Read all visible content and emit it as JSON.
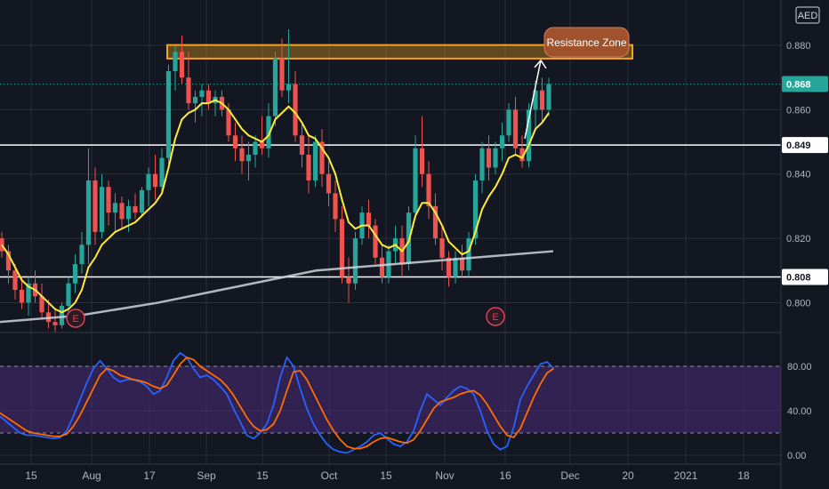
{
  "chart_data": [
    {
      "type": "candlestick",
      "currency": "AED",
      "y_axis_ticks": [
        "0.880",
        "0.860",
        "0.840",
        "0.820",
        "0.800"
      ],
      "ylim": [
        0.791,
        0.893
      ],
      "x_ticks": [
        "15",
        "Aug",
        "17",
        "Sep",
        "15",
        "Oct",
        "15",
        "Nov",
        "16",
        "Dec",
        "20",
        "2021",
        "18"
      ],
      "price_labels": [
        {
          "value": 0.868,
          "text": "0.868",
          "color": "#26a69a"
        },
        {
          "value": 0.849,
          "text": "0.849",
          "color": "#ffffff"
        },
        {
          "value": 0.808,
          "text": "0.808",
          "color": "#ffffff"
        }
      ],
      "horizontal_lines": [
        0.849,
        0.808
      ],
      "resistance_zone": {
        "low": 0.877,
        "high": 0.879,
        "label": "Resistance Zone"
      },
      "event_markers": [
        "E",
        "E"
      ],
      "ohlc": [
        [
          0.82,
          0.822,
          0.814,
          0.816
        ],
        [
          0.816,
          0.818,
          0.806,
          0.81
        ],
        [
          0.81,
          0.812,
          0.801,
          0.804
        ],
        [
          0.804,
          0.808,
          0.798,
          0.8
        ],
        [
          0.8,
          0.808,
          0.796,
          0.806
        ],
        [
          0.806,
          0.81,
          0.8,
          0.802
        ],
        [
          0.802,
          0.806,
          0.795,
          0.797
        ],
        [
          0.797,
          0.801,
          0.792,
          0.794
        ],
        [
          0.794,
          0.798,
          0.791,
          0.793
        ],
        [
          0.793,
          0.8,
          0.792,
          0.799
        ],
        [
          0.799,
          0.808,
          0.797,
          0.806
        ],
        [
          0.806,
          0.815,
          0.803,
          0.812
        ],
        [
          0.812,
          0.822,
          0.809,
          0.818
        ],
        [
          0.818,
          0.848,
          0.812,
          0.838
        ],
        [
          0.838,
          0.842,
          0.818,
          0.822
        ],
        [
          0.822,
          0.84,
          0.82,
          0.836
        ],
        [
          0.836,
          0.838,
          0.824,
          0.828
        ],
        [
          0.828,
          0.834,
          0.822,
          0.831
        ],
        [
          0.831,
          0.833,
          0.823,
          0.826
        ],
        [
          0.826,
          0.832,
          0.822,
          0.83
        ],
        [
          0.83,
          0.834,
          0.826,
          0.828
        ],
        [
          0.828,
          0.836,
          0.827,
          0.835
        ],
        [
          0.835,
          0.842,
          0.83,
          0.84
        ],
        [
          0.84,
          0.846,
          0.832,
          0.836
        ],
        [
          0.836,
          0.848,
          0.834,
          0.845
        ],
        [
          0.845,
          0.874,
          0.843,
          0.872
        ],
        [
          0.872,
          0.88,
          0.866,
          0.878
        ],
        [
          0.878,
          0.883,
          0.868,
          0.87
        ],
        [
          0.87,
          0.878,
          0.86,
          0.862
        ],
        [
          0.862,
          0.866,
          0.856,
          0.864
        ],
        [
          0.864,
          0.868,
          0.858,
          0.866
        ],
        [
          0.866,
          0.868,
          0.86,
          0.862
        ],
        [
          0.862,
          0.866,
          0.858,
          0.864
        ],
        [
          0.864,
          0.866,
          0.858,
          0.86
        ],
        [
          0.86,
          0.862,
          0.85,
          0.852
        ],
        [
          0.852,
          0.856,
          0.844,
          0.848
        ],
        [
          0.848,
          0.852,
          0.84,
          0.844
        ],
        [
          0.844,
          0.85,
          0.838,
          0.846
        ],
        [
          0.846,
          0.852,
          0.842,
          0.85
        ],
        [
          0.85,
          0.858,
          0.846,
          0.848
        ],
        [
          0.848,
          0.862,
          0.845,
          0.858
        ],
        [
          0.858,
          0.878,
          0.855,
          0.876
        ],
        [
          0.876,
          0.882,
          0.864,
          0.866
        ],
        [
          0.866,
          0.885,
          0.862,
          0.868
        ],
        [
          0.868,
          0.872,
          0.85,
          0.852
        ],
        [
          0.852,
          0.856,
          0.842,
          0.846
        ],
        [
          0.846,
          0.852,
          0.834,
          0.838
        ],
        [
          0.838,
          0.852,
          0.836,
          0.85
        ],
        [
          0.85,
          0.854,
          0.836,
          0.84
        ],
        [
          0.84,
          0.844,
          0.83,
          0.834
        ],
        [
          0.834,
          0.838,
          0.822,
          0.826
        ],
        [
          0.826,
          0.83,
          0.806,
          0.808
        ],
        [
          0.808,
          0.814,
          0.8,
          0.806
        ],
        [
          0.806,
          0.822,
          0.804,
          0.82
        ],
        [
          0.82,
          0.83,
          0.818,
          0.828
        ],
        [
          0.828,
          0.832,
          0.82,
          0.824
        ],
        [
          0.824,
          0.826,
          0.812,
          0.814
        ],
        [
          0.814,
          0.818,
          0.806,
          0.808
        ],
        [
          0.808,
          0.818,
          0.806,
          0.816
        ],
        [
          0.816,
          0.824,
          0.812,
          0.82
        ],
        [
          0.82,
          0.824,
          0.808,
          0.812
        ],
        [
          0.812,
          0.83,
          0.81,
          0.828
        ],
        [
          0.828,
          0.852,
          0.826,
          0.848
        ],
        [
          0.848,
          0.858,
          0.836,
          0.84
        ],
        [
          0.84,
          0.844,
          0.826,
          0.83
        ],
        [
          0.83,
          0.834,
          0.818,
          0.82
        ],
        [
          0.82,
          0.824,
          0.81,
          0.814
        ],
        [
          0.814,
          0.816,
          0.805,
          0.808
        ],
        [
          0.808,
          0.816,
          0.806,
          0.814
        ],
        [
          0.814,
          0.818,
          0.808,
          0.81
        ],
        [
          0.81,
          0.822,
          0.808,
          0.82
        ],
        [
          0.82,
          0.84,
          0.818,
          0.838
        ],
        [
          0.838,
          0.85,
          0.834,
          0.848
        ],
        [
          0.848,
          0.852,
          0.838,
          0.842
        ],
        [
          0.842,
          0.85,
          0.84,
          0.848
        ],
        [
          0.848,
          0.856,
          0.844,
          0.852
        ],
        [
          0.852,
          0.862,
          0.85,
          0.86
        ],
        [
          0.86,
          0.864,
          0.846,
          0.848
        ],
        [
          0.848,
          0.852,
          0.842,
          0.844
        ],
        [
          0.844,
          0.862,
          0.842,
          0.86
        ],
        [
          0.86,
          0.869,
          0.854,
          0.866
        ],
        [
          0.866,
          0.87,
          0.856,
          0.86
        ],
        [
          0.86,
          0.87,
          0.858,
          0.868
        ]
      ],
      "ma_short": [
        0.818,
        0.815,
        0.811,
        0.807,
        0.805,
        0.804,
        0.802,
        0.8,
        0.798,
        0.797,
        0.798,
        0.8,
        0.804,
        0.811,
        0.814,
        0.818,
        0.82,
        0.822,
        0.823,
        0.824,
        0.825,
        0.827,
        0.829,
        0.831,
        0.834,
        0.842,
        0.851,
        0.857,
        0.859,
        0.86,
        0.862,
        0.862,
        0.863,
        0.862,
        0.86,
        0.857,
        0.854,
        0.852,
        0.851,
        0.85,
        0.852,
        0.857,
        0.859,
        0.861,
        0.859,
        0.856,
        0.852,
        0.851,
        0.848,
        0.845,
        0.84,
        0.832,
        0.825,
        0.823,
        0.824,
        0.824,
        0.821,
        0.818,
        0.817,
        0.818,
        0.816,
        0.819,
        0.827,
        0.831,
        0.831,
        0.828,
        0.824,
        0.819,
        0.817,
        0.815,
        0.816,
        0.822,
        0.829,
        0.833,
        0.836,
        0.84,
        0.845,
        0.846,
        0.845,
        0.849,
        0.854,
        0.856,
        0.859
      ],
      "ma_long": [
        0.794,
        0.796,
        0.8,
        0.805,
        0.81,
        0.812,
        0.814,
        0.816
      ],
      "stochastic_rsi": {
        "overbought": 80,
        "oversold": 20,
        "y_ticks": [
          "80.00",
          "40.00",
          "0.00"
        ],
        "k": [
          35,
          30,
          25,
          20,
          18,
          18,
          17,
          16,
          15,
          16,
          22,
          35,
          50,
          65,
          78,
          85,
          78,
          70,
          66,
          68,
          68,
          66,
          62,
          55,
          58,
          70,
          85,
          92,
          88,
          78,
          70,
          72,
          68,
          62,
          55,
          42,
          30,
          18,
          15,
          20,
          28,
          45,
          70,
          88,
          80,
          60,
          42,
          28,
          18,
          10,
          5,
          3,
          2,
          5,
          8,
          12,
          18,
          20,
          15,
          10,
          8,
          12,
          22,
          40,
          55,
          50,
          45,
          52,
          58,
          62,
          60,
          55,
          40,
          22,
          10,
          5,
          8,
          25,
          50,
          62,
          72,
          82,
          84,
          78
        ],
        "d": [
          38,
          34,
          30,
          26,
          22,
          20,
          19,
          18,
          17,
          17,
          19,
          26,
          36,
          48,
          60,
          72,
          78,
          76,
          72,
          70,
          68,
          67,
          65,
          62,
          60,
          63,
          72,
          82,
          88,
          86,
          80,
          76,
          72,
          68,
          62,
          54,
          44,
          34,
          26,
          22,
          23,
          28,
          40,
          58,
          75,
          76,
          68,
          56,
          44,
          32,
          22,
          14,
          8,
          6,
          6,
          8,
          12,
          15,
          16,
          14,
          12,
          11,
          14,
          22,
          32,
          42,
          48,
          50,
          52,
          55,
          57,
          58,
          54,
          46,
          36,
          26,
          18,
          16,
          24,
          38,
          52,
          64,
          74,
          78
        ]
      }
    }
  ]
}
